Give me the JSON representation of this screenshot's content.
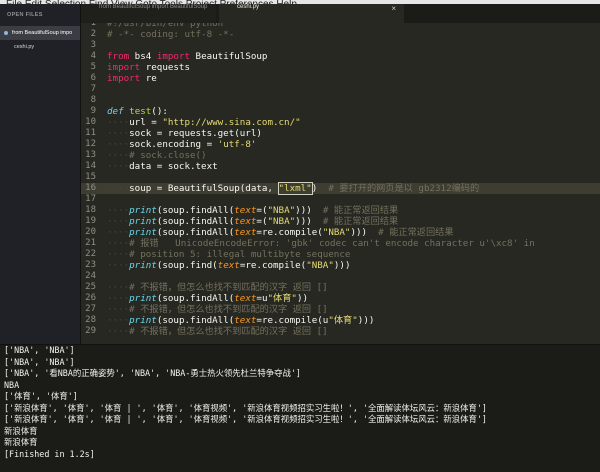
{
  "menubar": {
    "items": [
      "File",
      "Edit",
      "Selection",
      "Find",
      "View",
      "Goto",
      "Tools",
      "Project",
      "Preferences",
      "Help"
    ]
  },
  "sidebar": {
    "header": "OPEN FILES",
    "open_files": [
      "from BeautifulSoup impo",
      "ceshi.py"
    ]
  },
  "tabs": [
    {
      "label": "from BeautifulSoup import BeautifulSoup",
      "active": false
    },
    {
      "label": "ceshi.py",
      "active": true,
      "close": "×"
    }
  ],
  "editor": {
    "highlighted_line": "16",
    "lines": [
      {
        "n": "1",
        "tokens": [
          [
            "cm",
            "#!/usr/bin/env python"
          ]
        ]
      },
      {
        "n": "2",
        "tokens": [
          [
            "cm",
            "# -*- coding: utf-8 -*-"
          ]
        ]
      },
      {
        "n": "3",
        "tokens": []
      },
      {
        "n": "4",
        "tokens": [
          [
            "kw",
            "from"
          ],
          [
            "tx",
            " bs4 "
          ],
          [
            "kw",
            "import"
          ],
          [
            "tx",
            " BeautifulSoup"
          ]
        ]
      },
      {
        "n": "5",
        "tokens": [
          [
            "kw",
            "import"
          ],
          [
            "tx",
            " requests"
          ]
        ]
      },
      {
        "n": "6",
        "tokens": [
          [
            "kw",
            "import"
          ],
          [
            "tx",
            " re"
          ]
        ]
      },
      {
        "n": "7",
        "tokens": []
      },
      {
        "n": "8",
        "tokens": []
      },
      {
        "n": "9",
        "tokens": [
          [
            "def",
            "def"
          ],
          [
            "tx",
            " "
          ],
          [
            "fn",
            "test"
          ],
          [
            "tx",
            "():"
          ]
        ]
      },
      {
        "n": "10",
        "tokens": [
          [
            "dot",
            "····"
          ],
          [
            "tx",
            "url = "
          ],
          [
            "str",
            "\"http://www.sina.com.cn/\""
          ]
        ]
      },
      {
        "n": "11",
        "tokens": [
          [
            "dot",
            "····"
          ],
          [
            "tx",
            "sock = requests.get(url)"
          ]
        ]
      },
      {
        "n": "12",
        "tokens": [
          [
            "dot",
            "····"
          ],
          [
            "tx",
            "sock.encoding = "
          ],
          [
            "str",
            "'utf-8'"
          ]
        ]
      },
      {
        "n": "13",
        "tokens": [
          [
            "dot",
            "····"
          ],
          [
            "cm",
            "# sock.close()"
          ]
        ]
      },
      {
        "n": "14",
        "tokens": [
          [
            "dot",
            "····"
          ],
          [
            "tx",
            "data = sock.text"
          ]
        ]
      },
      {
        "n": "15",
        "tokens": []
      },
      {
        "n": "16",
        "tokens": [
          [
            "dot",
            "····"
          ],
          [
            "tx",
            "soup = BeautifulSoup(data, "
          ],
          [
            "str",
            "\"lxml\""
          ],
          [
            "tx",
            ")  "
          ],
          [
            "cm",
            "# 要打开的网页是以 gb2312编码的"
          ]
        ]
      },
      {
        "n": "17",
        "tokens": []
      },
      {
        "n": "18",
        "tokens": [
          [
            "dot",
            "····"
          ],
          [
            "def",
            "print"
          ],
          [
            "tx",
            "(soup.findAll("
          ],
          [
            "arg",
            "text"
          ],
          [
            "tx",
            "=("
          ],
          [
            "str",
            "\"NBA\""
          ],
          [
            "tx",
            ")))  "
          ],
          [
            "cm",
            "# 能正常返回结果"
          ]
        ]
      },
      {
        "n": "19",
        "tokens": [
          [
            "dot",
            "····"
          ],
          [
            "def",
            "print"
          ],
          [
            "tx",
            "(soup.findAll("
          ],
          [
            "arg",
            "text"
          ],
          [
            "tx",
            "=("
          ],
          [
            "str",
            "\"NBA\""
          ],
          [
            "tx",
            ")))  "
          ],
          [
            "cm",
            "# 能正常返回结果"
          ]
        ]
      },
      {
        "n": "20",
        "tokens": [
          [
            "dot",
            "····"
          ],
          [
            "def",
            "print"
          ],
          [
            "tx",
            "(soup.findAll("
          ],
          [
            "arg",
            "text"
          ],
          [
            "tx",
            "=re.compile("
          ],
          [
            "str",
            "\"NBA\""
          ],
          [
            "tx",
            ")))  "
          ],
          [
            "cm",
            "# 能正常返回结果"
          ]
        ]
      },
      {
        "n": "21",
        "tokens": [
          [
            "dot",
            "····"
          ],
          [
            "cm",
            "# 报错   UnicodeEncodeError: 'gbk' codec can't encode character u'\\xc8' in"
          ]
        ]
      },
      {
        "n": "22",
        "tokens": [
          [
            "dot",
            "····"
          ],
          [
            "cm",
            "# position 5: illegal multibyte sequence"
          ]
        ]
      },
      {
        "n": "23",
        "tokens": [
          [
            "dot",
            "····"
          ],
          [
            "def",
            "print"
          ],
          [
            "tx",
            "(soup.find("
          ],
          [
            "arg",
            "text"
          ],
          [
            "tx",
            "=re.compile("
          ],
          [
            "str",
            "\"NBA\""
          ],
          [
            "tx",
            ")))"
          ]
        ]
      },
      {
        "n": "24",
        "tokens": []
      },
      {
        "n": "25",
        "tokens": [
          [
            "dot",
            "····"
          ],
          [
            "cm",
            "# 不报错，但怎么也找不到匹配的汉字 返回 []"
          ]
        ]
      },
      {
        "n": "26",
        "tokens": [
          [
            "dot",
            "····"
          ],
          [
            "def",
            "print"
          ],
          [
            "tx",
            "(soup.findAll("
          ],
          [
            "arg",
            "text"
          ],
          [
            "tx",
            "=u"
          ],
          [
            "str",
            "\"体育\""
          ],
          [
            "tx",
            "))"
          ]
        ]
      },
      {
        "n": "27",
        "tokens": [
          [
            "dot",
            "····"
          ],
          [
            "cm",
            "# 不报错，但怎么也找不到匹配的汉字 返回 []"
          ]
        ]
      },
      {
        "n": "28",
        "tokens": [
          [
            "dot",
            "····"
          ],
          [
            "def",
            "print"
          ],
          [
            "tx",
            "(soup.findAll("
          ],
          [
            "arg",
            "text"
          ],
          [
            "tx",
            "=re.compile(u"
          ],
          [
            "str",
            "\"体育\""
          ],
          [
            "tx",
            ")))"
          ]
        ]
      },
      {
        "n": "29",
        "tokens": [
          [
            "dot",
            "····"
          ],
          [
            "cm",
            "# 不报错，但怎么也找不到匹配的汉字 返回 []"
          ]
        ]
      }
    ]
  },
  "output": {
    "lines": [
      "['NBA', 'NBA']",
      "['NBA', 'NBA']",
      "['NBA', '看NBA的正确姿势', 'NBA', 'NBA-勇士热火领先杜兰特争夺战']",
      "NBA",
      "['体育', '体育']",
      "['新浪体育', '体育', '体育 | ', '体育', '体育视频', '新浪体育视频招实习生啦！', '全面解读体坛风云：新浪体育']",
      "['新浪体育', '体育', '体育 | ', '体育', '体育视频', '新浪体育视频招实习生啦！', '全面解读体坛风云：新浪体育']",
      "新浪体育",
      "新浪体育",
      "[Finished in 1.2s]"
    ]
  },
  "colors": {
    "editor_bg": "#272822",
    "keyword": "#f92672",
    "function": "#a6e22e",
    "string": "#e6db74",
    "comment": "#75715e",
    "builtin": "#66d9ef",
    "argument": "#fd971f"
  }
}
